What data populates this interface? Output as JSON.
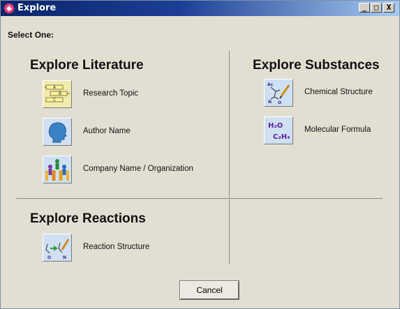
{
  "window": {
    "title": "Explore",
    "minimize_label": "_",
    "restore_label": "□",
    "close_label": "X"
  },
  "select_label": "Select One:",
  "sections": {
    "literature": {
      "title": "Explore Literature",
      "items": [
        {
          "label": "Research Topic",
          "icon": "research-topic-icon"
        },
        {
          "label": "Author Name",
          "icon": "author-head-icon"
        },
        {
          "label": "Company Name / Organization",
          "icon": "organization-icon"
        }
      ]
    },
    "substances": {
      "title": "Explore Substances",
      "items": [
        {
          "label": "Chemical Structure",
          "icon": "chemical-structure-icon"
        },
        {
          "label": "Molecular Formula",
          "icon": "molecular-formula-icon",
          "formula_line1": "H₂O",
          "formula_line2": "C₂H₄"
        }
      ]
    },
    "reactions": {
      "title": "Explore Reactions",
      "items": [
        {
          "label": "Reaction Structure",
          "icon": "reaction-structure-icon"
        }
      ]
    }
  },
  "cancel_label": "Cancel",
  "colors": {
    "titlebar": "#0a246a",
    "dialog_bg": "#e2ded2",
    "icon_bg": "#cfe0f3",
    "formula": "#5a1aa0"
  }
}
